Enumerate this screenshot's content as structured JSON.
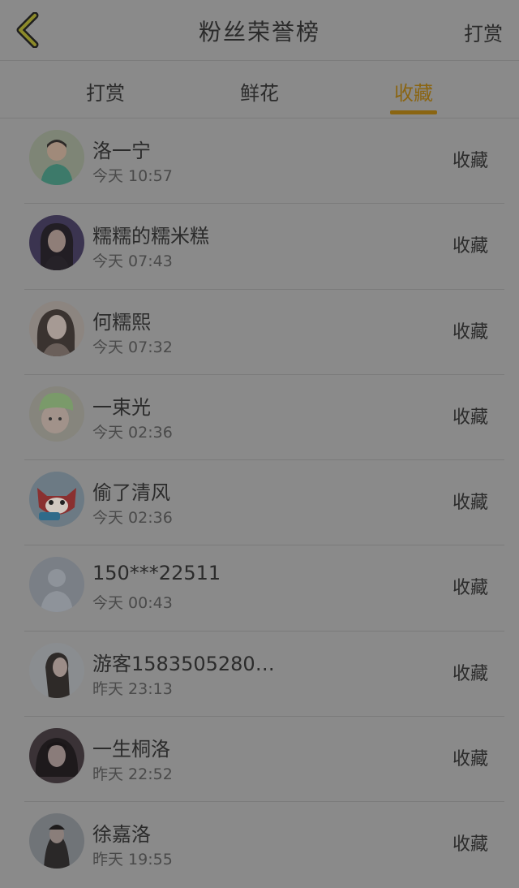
{
  "header": {
    "title": "粉丝荣誉榜",
    "right_action": "打赏"
  },
  "tabs": [
    {
      "label": "打赏",
      "active": false
    },
    {
      "label": "鲜花",
      "active": false
    },
    {
      "label": "收藏",
      "active": true
    }
  ],
  "accent_color": "#8a6512",
  "list": [
    {
      "name": "洛一宁",
      "time": "今天 10:57",
      "action": "收藏",
      "avatar": "avatar-man-green"
    },
    {
      "name": "糯糯的糯米糕",
      "time": "今天 07:43",
      "action": "收藏",
      "avatar": "avatar-woman-dark"
    },
    {
      "name": "何糯熙",
      "time": "今天 07:32",
      "action": "收藏",
      "avatar": "avatar-woman-light"
    },
    {
      "name": "一束光",
      "time": "今天 02:36",
      "action": "收藏",
      "avatar": "avatar-baby-hat"
    },
    {
      "name": "偷了清风",
      "time": "今天 02:36",
      "action": "收藏",
      "avatar": "avatar-red-fox"
    },
    {
      "name": "150***22511",
      "time": "今天 00:43",
      "action": "收藏",
      "avatar": "avatar-default"
    },
    {
      "name": "游客1583505280…",
      "time": "昨天 23:13",
      "action": "收藏",
      "avatar": "avatar-woman-profile"
    },
    {
      "name": "一生桐洛",
      "time": "昨天 22:52",
      "action": "收藏",
      "avatar": "avatar-woman-hair"
    },
    {
      "name": "徐嘉洛",
      "time": "昨天 19:55",
      "action": "收藏",
      "avatar": "avatar-woman-dark2"
    }
  ]
}
